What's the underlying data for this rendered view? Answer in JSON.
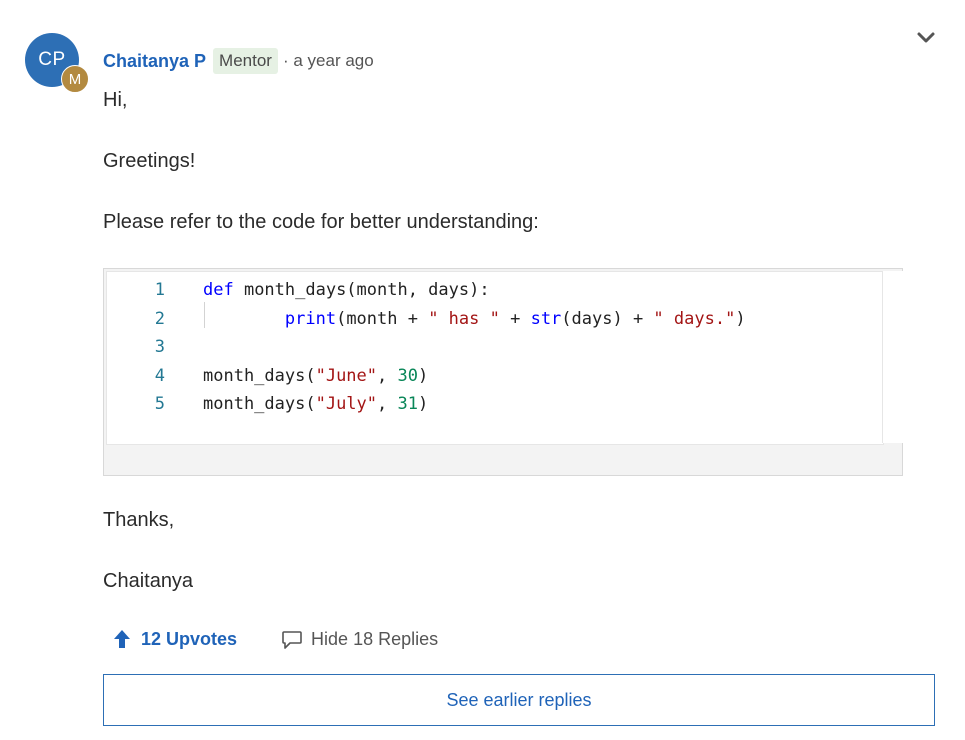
{
  "author": {
    "initials": "CP",
    "badge_initial": "M",
    "name": "Chaitanya P",
    "role": "Mentor",
    "time": "· a year ago"
  },
  "body": {
    "line1": "Hi,",
    "line2": "Greetings!",
    "line3": "Please refer to the code for better  understanding:",
    "line4": "Thanks,",
    "line5": "Chaitanya"
  },
  "code": {
    "line_numbers": [
      "1",
      "2",
      "3",
      "4",
      "5"
    ],
    "lines": [
      [
        {
          "t": "kw",
          "v": "def"
        },
        {
          "t": "txt",
          "v": " month_days(month, days):"
        }
      ],
      [
        {
          "t": "txt",
          "v": "        "
        },
        {
          "t": "fn",
          "v": "print"
        },
        {
          "t": "txt",
          "v": "(month + "
        },
        {
          "t": "str",
          "v": "\" has \""
        },
        {
          "t": "txt",
          "v": " + "
        },
        {
          "t": "fn",
          "v": "str"
        },
        {
          "t": "txt",
          "v": "(days) + "
        },
        {
          "t": "str",
          "v": "\" days.\""
        },
        {
          "t": "txt",
          "v": ")"
        }
      ],
      [],
      [
        {
          "t": "txt",
          "v": "month_days("
        },
        {
          "t": "str",
          "v": "\"June\""
        },
        {
          "t": "txt",
          "v": ", "
        },
        {
          "t": "num",
          "v": "30"
        },
        {
          "t": "txt",
          "v": ")"
        }
      ],
      [
        {
          "t": "txt",
          "v": "month_days("
        },
        {
          "t": "str",
          "v": "\"July\""
        },
        {
          "t": "txt",
          "v": ", "
        },
        {
          "t": "num",
          "v": "31"
        },
        {
          "t": "txt",
          "v": ")"
        }
      ]
    ]
  },
  "actions": {
    "upvotes_label": "12 Upvotes",
    "replies_label": "Hide 18 Replies",
    "earlier_label": "See earlier replies"
  },
  "icons": {
    "upvote": "arrow-up-icon",
    "replies": "speech-bubble-icon",
    "collapse": "chevron-down-icon"
  },
  "colors": {
    "accent": "#1f63b8",
    "avatar": "#2d6fb5",
    "badge": "#b38a40",
    "role_bg": "#e6f1e4"
  }
}
